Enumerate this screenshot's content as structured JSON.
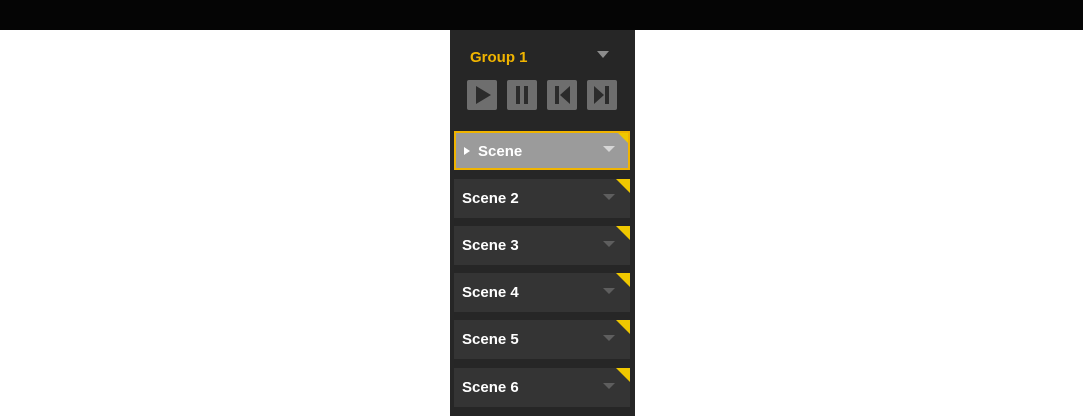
{
  "group": {
    "title": "Group 1",
    "dropdown_icon": "chevron-down-icon"
  },
  "transport": [
    {
      "name": "play-button",
      "icon": "play-icon"
    },
    {
      "name": "pause-button",
      "icon": "pause-icon"
    },
    {
      "name": "previous-button",
      "icon": "skip-back-icon"
    },
    {
      "name": "next-button",
      "icon": "skip-forward-icon"
    }
  ],
  "scenes": [
    {
      "label": "Scene",
      "active": true
    },
    {
      "label": "Scene 2",
      "active": false
    },
    {
      "label": "Scene 3",
      "active": false
    },
    {
      "label": "Scene 4",
      "active": false
    },
    {
      "label": "Scene 5",
      "active": false
    },
    {
      "label": "Scene 6",
      "active": false
    }
  ],
  "colors": {
    "accent": "#f0b400",
    "panel": "#262626",
    "scene_bg": "#343434",
    "active_scene_bg": "#9b9b9b",
    "button": "#6e6e6e"
  }
}
